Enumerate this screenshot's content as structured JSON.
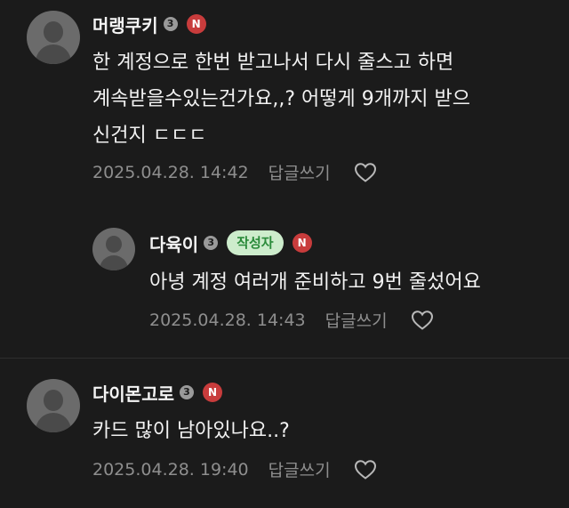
{
  "comments": [
    {
      "nickname": "머랭쿠키",
      "level": "3",
      "badge": "N",
      "lines": [
        "한 계정으로 한번 받고나서 다시 줄스고 하면",
        "계속받을수있는건가요,,? 어떻게 9개까지 받으",
        "신건지 ㄷㄷㄷ"
      ],
      "date": "2025.04.28. 14:42",
      "reply_label": "답글쓰기"
    },
    {
      "nickname": "다육이",
      "level": "3",
      "author_badge": "작성자",
      "badge": "N",
      "lines": [
        "아녕 계정 여러개 준비하고 9번 줄섰어요"
      ],
      "date": "2025.04.28. 14:43",
      "reply_label": "답글쓰기"
    },
    {
      "nickname": "다이몬고로",
      "level": "3",
      "badge": "N",
      "lines": [
        "카드 많이 남아있나요..?"
      ],
      "date": "2025.04.28. 19:40",
      "reply_label": "답글쓰기"
    }
  ],
  "colors": {
    "background": "#1b1b1b",
    "n_badge": "#c83c3c",
    "author_badge_bg": "#cdeccc",
    "author_badge_text": "#2a8a3a",
    "meta_text": "#8e8e8e"
  },
  "icons": {
    "avatar": "default-profile-icon",
    "like": "heart-outline-icon"
  }
}
